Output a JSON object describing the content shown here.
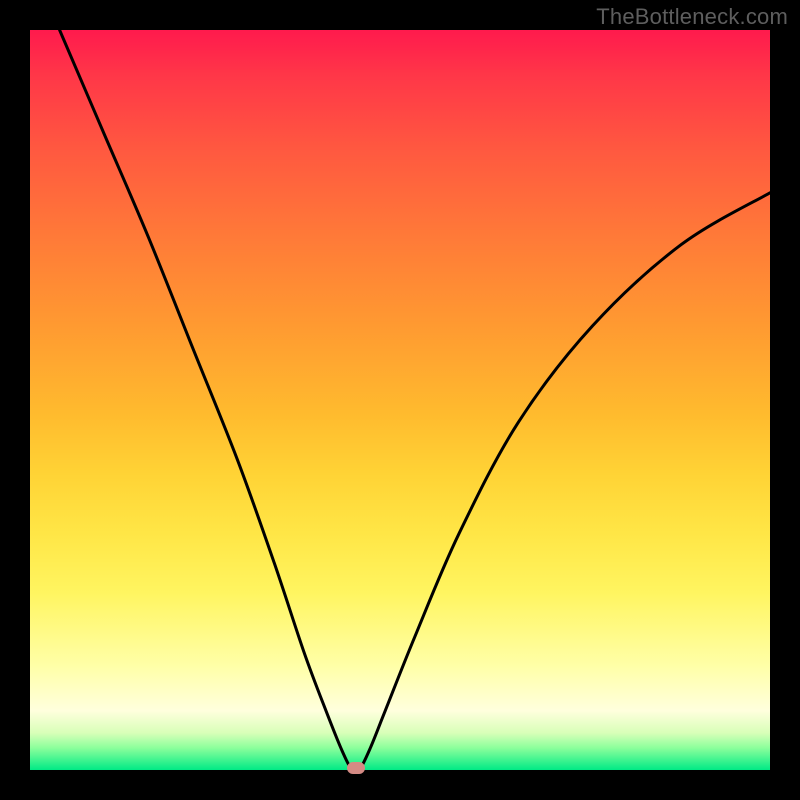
{
  "watermark": "TheBottleneck.com",
  "chart_data": {
    "type": "line",
    "title": "",
    "xlabel": "",
    "ylabel": "",
    "xlim": [
      0,
      100
    ],
    "ylim": [
      0,
      100
    ],
    "grid": false,
    "series": [
      {
        "name": "bottleneck-curve",
        "x": [
          4,
          10,
          16,
          22,
          28,
          33,
          37,
          40,
          42,
          43.5,
          44.5,
          46,
          48,
          52,
          58,
          66,
          76,
          88,
          100
        ],
        "values": [
          100,
          86,
          72,
          57,
          42,
          28,
          16,
          8,
          3,
          0,
          0,
          3,
          8,
          18,
          32,
          47,
          60,
          71,
          78
        ]
      }
    ],
    "marker": {
      "x": 44,
      "y": 0
    },
    "background_gradient": {
      "top": "#ff1a4d",
      "mid": "#ffd335",
      "bottom": "#00ea86"
    }
  }
}
